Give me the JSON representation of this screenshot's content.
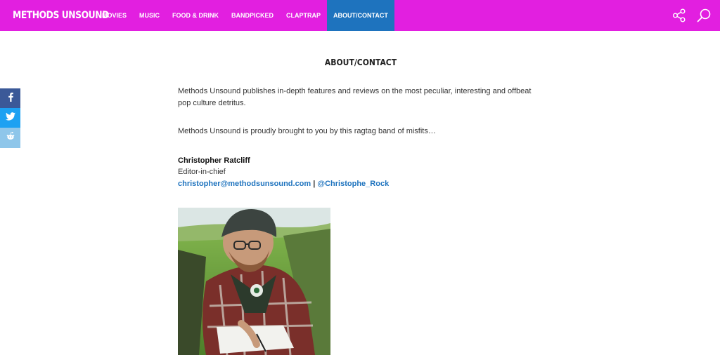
{
  "header": {
    "logo": "METHODS UNSOUND",
    "nav": [
      "MOVIES",
      "MUSIC",
      "FOOD & DRINK",
      "BANDPICKED",
      "CLAPTRAP",
      "ABOUT/CONTACT"
    ],
    "active_index": 5,
    "icons": [
      "share-icon",
      "search-icon"
    ],
    "brand_color": "#e21fe0",
    "active_color": "#1e73be"
  },
  "share_bar": {
    "icons": [
      "facebook-icon",
      "twitter-icon",
      "reddit-icon"
    ],
    "colors": [
      "#3b5998",
      "#1da1f2",
      "#8ec6ea"
    ]
  },
  "page": {
    "title": "ABOUT/CONTACT",
    "intro": "Methods Unsound publishes in-depth features and reviews on the most peculiar, interesting and offbeat pop culture detritus.",
    "crew_line": "Methods Unsound is proudly brought to you by this ragtag band of misfits…",
    "person": {
      "name": "Christopher Ratcliff",
      "role": "Editor-in-chief",
      "email": "christopher@methodsunsound.com",
      "separator": "|",
      "handle": "@Christophe_Rock"
    }
  }
}
